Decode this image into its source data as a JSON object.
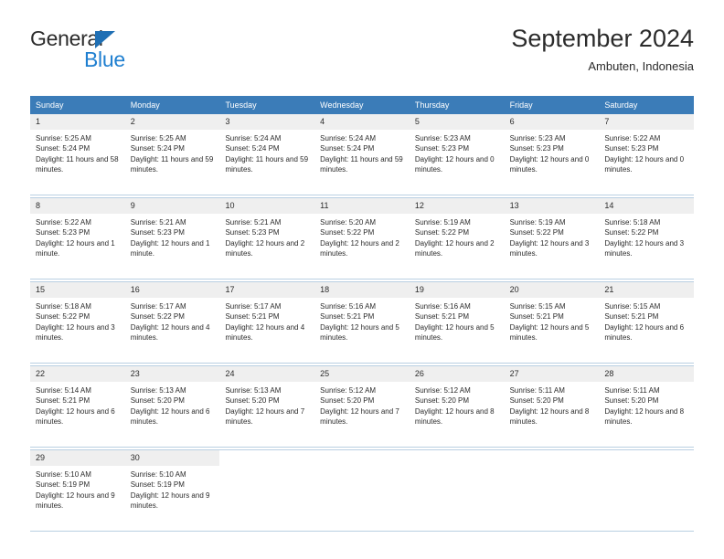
{
  "brand": {
    "name_part1": "General",
    "name_part2": "Blue",
    "triangle_color": "#1f6fb4",
    "blue_color": "#1f7fd0"
  },
  "header": {
    "title": "September 2024",
    "subtitle": "Ambuten, Indonesia"
  },
  "theme": {
    "header_blue": "#3b7cb8",
    "row_border": "#b9cfe2",
    "day_number_bg": "#efefef",
    "text": "#2b2b2b"
  },
  "weekdays": [
    "Sunday",
    "Monday",
    "Tuesday",
    "Wednesday",
    "Thursday",
    "Friday",
    "Saturday"
  ],
  "weeks": [
    [
      {
        "day": "1",
        "sunrise": "Sunrise: 5:25 AM",
        "sunset": "Sunset: 5:24 PM",
        "daylight": "Daylight: 11 hours and 58 minutes."
      },
      {
        "day": "2",
        "sunrise": "Sunrise: 5:25 AM",
        "sunset": "Sunset: 5:24 PM",
        "daylight": "Daylight: 11 hours and 59 minutes."
      },
      {
        "day": "3",
        "sunrise": "Sunrise: 5:24 AM",
        "sunset": "Sunset: 5:24 PM",
        "daylight": "Daylight: 11 hours and 59 minutes."
      },
      {
        "day": "4",
        "sunrise": "Sunrise: 5:24 AM",
        "sunset": "Sunset: 5:24 PM",
        "daylight": "Daylight: 11 hours and 59 minutes."
      },
      {
        "day": "5",
        "sunrise": "Sunrise: 5:23 AM",
        "sunset": "Sunset: 5:23 PM",
        "daylight": "Daylight: 12 hours and 0 minutes."
      },
      {
        "day": "6",
        "sunrise": "Sunrise: 5:23 AM",
        "sunset": "Sunset: 5:23 PM",
        "daylight": "Daylight: 12 hours and 0 minutes."
      },
      {
        "day": "7",
        "sunrise": "Sunrise: 5:22 AM",
        "sunset": "Sunset: 5:23 PM",
        "daylight": "Daylight: 12 hours and 0 minutes."
      }
    ],
    [
      {
        "day": "8",
        "sunrise": "Sunrise: 5:22 AM",
        "sunset": "Sunset: 5:23 PM",
        "daylight": "Daylight: 12 hours and 1 minute."
      },
      {
        "day": "9",
        "sunrise": "Sunrise: 5:21 AM",
        "sunset": "Sunset: 5:23 PM",
        "daylight": "Daylight: 12 hours and 1 minute."
      },
      {
        "day": "10",
        "sunrise": "Sunrise: 5:21 AM",
        "sunset": "Sunset: 5:23 PM",
        "daylight": "Daylight: 12 hours and 2 minutes."
      },
      {
        "day": "11",
        "sunrise": "Sunrise: 5:20 AM",
        "sunset": "Sunset: 5:22 PM",
        "daylight": "Daylight: 12 hours and 2 minutes."
      },
      {
        "day": "12",
        "sunrise": "Sunrise: 5:19 AM",
        "sunset": "Sunset: 5:22 PM",
        "daylight": "Daylight: 12 hours and 2 minutes."
      },
      {
        "day": "13",
        "sunrise": "Sunrise: 5:19 AM",
        "sunset": "Sunset: 5:22 PM",
        "daylight": "Daylight: 12 hours and 3 minutes."
      },
      {
        "day": "14",
        "sunrise": "Sunrise: 5:18 AM",
        "sunset": "Sunset: 5:22 PM",
        "daylight": "Daylight: 12 hours and 3 minutes."
      }
    ],
    [
      {
        "day": "15",
        "sunrise": "Sunrise: 5:18 AM",
        "sunset": "Sunset: 5:22 PM",
        "daylight": "Daylight: 12 hours and 3 minutes."
      },
      {
        "day": "16",
        "sunrise": "Sunrise: 5:17 AM",
        "sunset": "Sunset: 5:22 PM",
        "daylight": "Daylight: 12 hours and 4 minutes."
      },
      {
        "day": "17",
        "sunrise": "Sunrise: 5:17 AM",
        "sunset": "Sunset: 5:21 PM",
        "daylight": "Daylight: 12 hours and 4 minutes."
      },
      {
        "day": "18",
        "sunrise": "Sunrise: 5:16 AM",
        "sunset": "Sunset: 5:21 PM",
        "daylight": "Daylight: 12 hours and 5 minutes."
      },
      {
        "day": "19",
        "sunrise": "Sunrise: 5:16 AM",
        "sunset": "Sunset: 5:21 PM",
        "daylight": "Daylight: 12 hours and 5 minutes."
      },
      {
        "day": "20",
        "sunrise": "Sunrise: 5:15 AM",
        "sunset": "Sunset: 5:21 PM",
        "daylight": "Daylight: 12 hours and 5 minutes."
      },
      {
        "day": "21",
        "sunrise": "Sunrise: 5:15 AM",
        "sunset": "Sunset: 5:21 PM",
        "daylight": "Daylight: 12 hours and 6 minutes."
      }
    ],
    [
      {
        "day": "22",
        "sunrise": "Sunrise: 5:14 AM",
        "sunset": "Sunset: 5:21 PM",
        "daylight": "Daylight: 12 hours and 6 minutes."
      },
      {
        "day": "23",
        "sunrise": "Sunrise: 5:13 AM",
        "sunset": "Sunset: 5:20 PM",
        "daylight": "Daylight: 12 hours and 6 minutes."
      },
      {
        "day": "24",
        "sunrise": "Sunrise: 5:13 AM",
        "sunset": "Sunset: 5:20 PM",
        "daylight": "Daylight: 12 hours and 7 minutes."
      },
      {
        "day": "25",
        "sunrise": "Sunrise: 5:12 AM",
        "sunset": "Sunset: 5:20 PM",
        "daylight": "Daylight: 12 hours and 7 minutes."
      },
      {
        "day": "26",
        "sunrise": "Sunrise: 5:12 AM",
        "sunset": "Sunset: 5:20 PM",
        "daylight": "Daylight: 12 hours and 8 minutes."
      },
      {
        "day": "27",
        "sunrise": "Sunrise: 5:11 AM",
        "sunset": "Sunset: 5:20 PM",
        "daylight": "Daylight: 12 hours and 8 minutes."
      },
      {
        "day": "28",
        "sunrise": "Sunrise: 5:11 AM",
        "sunset": "Sunset: 5:20 PM",
        "daylight": "Daylight: 12 hours and 8 minutes."
      }
    ],
    [
      {
        "day": "29",
        "sunrise": "Sunrise: 5:10 AM",
        "sunset": "Sunset: 5:19 PM",
        "daylight": "Daylight: 12 hours and 9 minutes."
      },
      {
        "day": "30",
        "sunrise": "Sunrise: 5:10 AM",
        "sunset": "Sunset: 5:19 PM",
        "daylight": "Daylight: 12 hours and 9 minutes."
      },
      {
        "day": "",
        "sunrise": "",
        "sunset": "",
        "daylight": ""
      },
      {
        "day": "",
        "sunrise": "",
        "sunset": "",
        "daylight": ""
      },
      {
        "day": "",
        "sunrise": "",
        "sunset": "",
        "daylight": ""
      },
      {
        "day": "",
        "sunrise": "",
        "sunset": "",
        "daylight": ""
      },
      {
        "day": "",
        "sunrise": "",
        "sunset": "",
        "daylight": ""
      }
    ]
  ]
}
